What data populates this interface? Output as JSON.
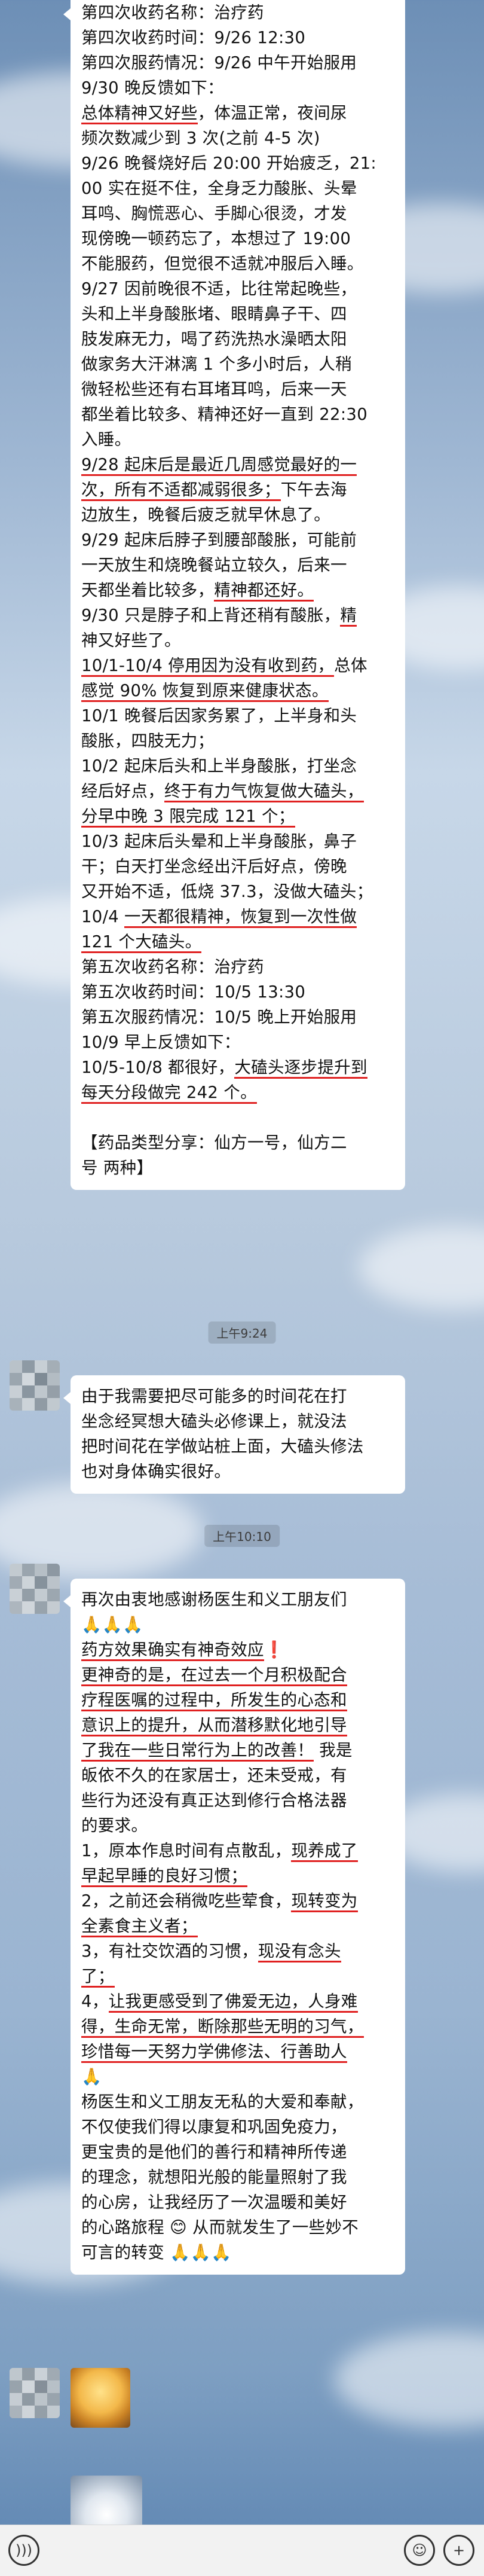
{
  "chat": {
    "msg1": {
      "lines": [
        "第四次收药名称：治疗药",
        "第四次收药时间：9/26 12:30",
        "第四次服药情况：9/26 中午开始服用",
        "9/30 晚反馈如下：",
        [
          "总体精神又好些",
          "，体温正常，夜间尿"
        ],
        "频次数减少到 3 次(之前 4-5 次)",
        "9/26 晚餐烧好后 20:00 开始疲乏，21:",
        "00 实在挺不住，全身乏力酸胀、头晕",
        "耳鸣、胸慌恶心、手脚心很烫，才发",
        "现傍晚一顿药忘了，本想过了 19:00",
        "不能服药，但觉很不适就冲服后入睡。",
        "9/27 因前晚很不适，比往常起晚些，",
        "头和上半身酸胀堵、眼睛鼻子干、四",
        "肢发麻无力，喝了药洗热水澡晒太阳",
        "做家务大汗淋漓 1 个多小时后，人稍",
        "微轻松些还有右耳堵耳鸣，后来一天",
        "都坐着比较多、精神还好一直到 22:30",
        "入睡。",
        [
          "9/28 起床后是最近几周感觉最好的一",
          ""
        ],
        [
          "次，所有不适都减弱很多；",
          "下午去海"
        ],
        "边放生，晚餐后疲乏就早休息了。",
        "9/29 起床后脖子到腰部酸胀，可能前",
        "一天放生和烧晚餐站立较久，后来一",
        [
          "天都坐着比较多，",
          "精神都还好。"
        ],
        [
          "9/30 只是脖子和上背还稍有酸胀，",
          "精"
        ],
        [
          "神又好些了。",
          ""
        ],
        [
          "10/1-10/4 停用因为没有收到药，",
          "总体"
        ],
        [
          "感觉 90% 恢复到原来健康状态。",
          ""
        ],
        "10/1 晚餐后因家务累了，上半身和头",
        "酸胀，四肢无力；",
        "10/2 起床后头和上半身酸胀，打坐念",
        [
          "经后好点，",
          "终于有力气恢复做大磕头，"
        ],
        [
          "分早中晚 3 限完成 121 个；",
          ""
        ],
        "10/3 起床后头晕和上半身酸胀，鼻子",
        "干；白天打坐念经出汗后好点，傍晚",
        "又开始不适，低烧 37.3，没做大磕头；",
        [
          "10/4 ",
          "一天都很精神，恢复到一次性做"
        ],
        [
          "121 个大磕头。",
          ""
        ],
        "第五次收药名称：治疗药",
        "第五次收药时间：10/5 13:30",
        "第五次服药情况：10/5 晚上开始服用",
        "10/9 早上反馈如下：",
        [
          "10/5-10/8 都很好，",
          "大磕头逐步提升到"
        ],
        [
          "每天分段做完 242 个。",
          ""
        ],
        "",
        "【药品类型分享：仙方一号，仙方二",
        "号  两种】"
      ]
    },
    "time1": "上午9:24",
    "msg2": {
      "lines": [
        "由于我需要把尽可能多的时间花在打",
        "坐念经冥想大磕头必修课上，就没法",
        "把时间花在学做站桩上面，大磕头修法",
        "也对身体确实很好。"
      ]
    },
    "time2": "上午10:10",
    "msg3": {
      "lines": [
        "再次由衷地感谢杨医生和义工朋友们",
        "🙏🙏🙏",
        [
          "药方效果确实有神奇效应",
          "❗"
        ],
        [
          "更神奇的是，在过去一个月积极配合",
          ""
        ],
        [
          "疗程医嘱的过程中，所发生的心态和",
          ""
        ],
        [
          "意识上的提升，从而潜移默化地引导",
          ""
        ],
        [
          "了我在一些日常行为上的改善！",
          " 我是"
        ],
        "皈依不久的在家居士，还未受戒，有",
        "些行为还没有真正达到修行合格法器",
        "的要求。",
        [
          "1，原本作息时间有点散乱，",
          "现养成了"
        ],
        [
          "早起早睡的良好习惯；",
          ""
        ],
        [
          "2，之前还会稍微吃些荤食，",
          "现转变为"
        ],
        [
          "全素食主义者；",
          ""
        ],
        [
          "3，有社交饮酒的习惯，",
          "现没有念头"
        ],
        [
          "了；",
          ""
        ],
        [
          "4，",
          "让我更感受到了佛爱无边，人身难"
        ],
        [
          "得，生命无常，断除那些无明的习气，",
          ""
        ],
        [
          "珍惜每一天努力学佛修法、行善助人",
          ""
        ],
        "🙏",
        "杨医生和义工朋友无私的大爱和奉献，",
        "不仅使我们得以康复和巩固免疫力，",
        "更宝贵的是他们的善行和精神所传递",
        "的理念，就想阳光般的能量照射了我",
        "的心房，让我经历了一次温暖和美好",
        "的心路旅程 😊 从而就发生了一些妙不",
        "可言的转变 🙏🙏🙏"
      ]
    }
  },
  "icons": {
    "voice": "voice-icon",
    "emoji": "emoji-icon",
    "plus": "plus-icon"
  },
  "colors": {
    "underline": "#e02020",
    "bubble": "#ffffff",
    "timestamp_bg": "#00000020"
  }
}
